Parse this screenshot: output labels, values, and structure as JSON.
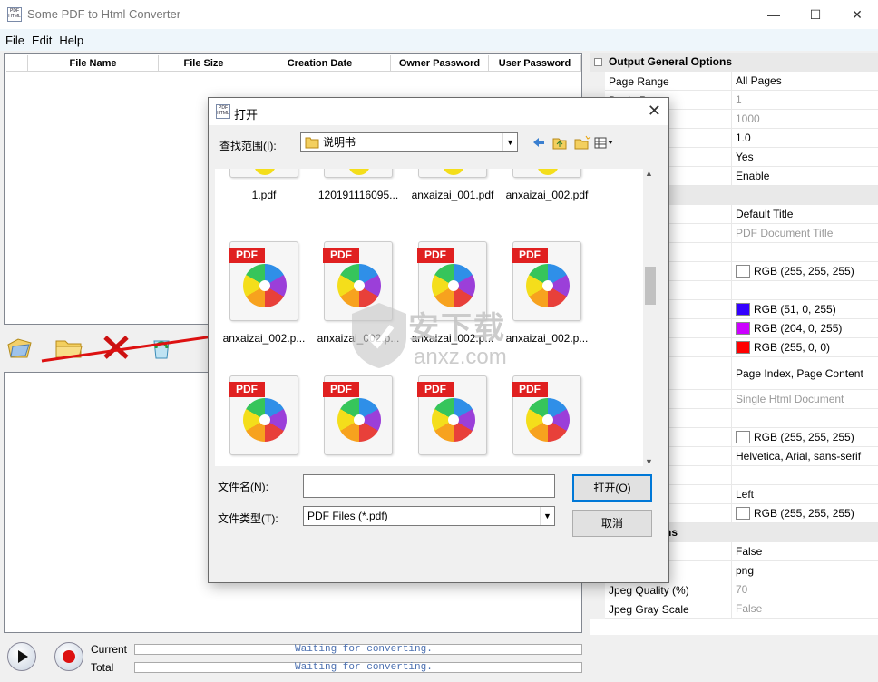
{
  "window": {
    "title": "Some PDF to Html Converter",
    "controls": [
      "—",
      "☐",
      "✕"
    ]
  },
  "menu": [
    {
      "label": "File"
    },
    {
      "label": "Edit"
    },
    {
      "label": "Help"
    }
  ],
  "file_list": {
    "columns": [
      "",
      "File Name",
      "File Size",
      "Creation Date",
      "Owner Password",
      "User Password"
    ]
  },
  "toolbar": {
    "buttons": [
      "add-file",
      "add-folder",
      "remove",
      "clear"
    ]
  },
  "progress": {
    "current_label": "Current",
    "total_label": "Total",
    "current_text": "Waiting for converting.",
    "total_text": "Waiting for converting."
  },
  "properties": {
    "sections": [
      {
        "title": "Output General Options",
        "rows": [
          {
            "name": "Page Range",
            "value": "All Pages",
            "gray": false
          },
          {
            "name": "Begin Page",
            "value": "1",
            "gray": true
          },
          {
            "name": "",
            "value": "1000",
            "gray": true
          },
          {
            "name": "",
            "value": "1.0",
            "gray": false
          },
          {
            "name": "s",
            "value": "Yes",
            "gray": false
          },
          {
            "name": "",
            "value": "Enable",
            "gray": false
          }
        ]
      },
      {
        "title": "ml Options",
        "rows": [
          {
            "name": "l Title",
            "value": "Default Title",
            "gray": false
          },
          {
            "name": "itle",
            "value": "PDF Document Title",
            "gray": true
          },
          {
            "name": "l KeyWords",
            "value": "",
            "gray": false
          },
          {
            "name": "",
            "value": "RGB (255, 255, 255)",
            "gray": false,
            "swatch": "#ffffff"
          },
          {
            "name": "",
            "value": "",
            "gray": false
          },
          {
            "name": "r",
            "value": "RGB (51, 0, 255)",
            "gray": false,
            "swatch": "#3300ff"
          },
          {
            "name": "nks Color",
            "value": "RGB (204, 0, 255)",
            "gray": false,
            "swatch": "#cc00ff"
          },
          {
            "name": "nks Color",
            "value": "RGB (255, 0, 0)",
            "gray": false,
            "swatch": "#ff0000"
          }
        ]
      }
    ],
    "extra_rows": [
      {
        "name": "Structures",
        "value": "Page Index, Page Content"
      },
      {
        "name": "out Mode",
        "value": "Single Html Document",
        "gray": true
      },
      {
        "name": "",
        "value": ""
      },
      {
        "name": "nd",
        "value": "RGB (255, 255, 255)",
        "swatch": "#ffffff"
      },
      {
        "name": "",
        "value": "Helvetica, Arial, sans-serif"
      },
      {
        "name": "",
        "value": ""
      },
      {
        "name": "",
        "value": "Left"
      },
      {
        "name": "nd",
        "value": "RGB (255, 255, 255)",
        "swatch": "#ffffff"
      }
    ],
    "images_section": "ages Options",
    "image_rows": [
      {
        "name": "es",
        "value": "False"
      },
      {
        "name": "at",
        "value": "png"
      },
      {
        "name": "Jpeg Quality (%)",
        "value": "70",
        "gray": true
      },
      {
        "name": "Jpeg Gray Scale",
        "value": "False",
        "gray": true
      }
    ]
  },
  "dialog": {
    "title": "打开",
    "lookin_label": "查找范围(I):",
    "lookin_value": "说明书",
    "filename_label": "文件名(N):",
    "filename_value": "",
    "filetype_label": "文件类型(T):",
    "filetype_value": "PDF Files (*.pdf)",
    "open_button": "打开(O)",
    "cancel_button": "取消",
    "pdf_tag": "PDF",
    "files_row1": [
      "1.pdf",
      "120191116095...",
      "anxaizai_001.pdf",
      "anxaizai_002.pdf"
    ],
    "files_row2": [
      "anxaizai_002.p...",
      "anxaizai_002.p...",
      "anxaizai_002.p...",
      "anxaizai_002.p..."
    ],
    "files_row3": [
      "",
      "",
      "",
      ""
    ]
  },
  "watermark": {
    "cn": "安下载",
    "en": "anxz.com"
  }
}
